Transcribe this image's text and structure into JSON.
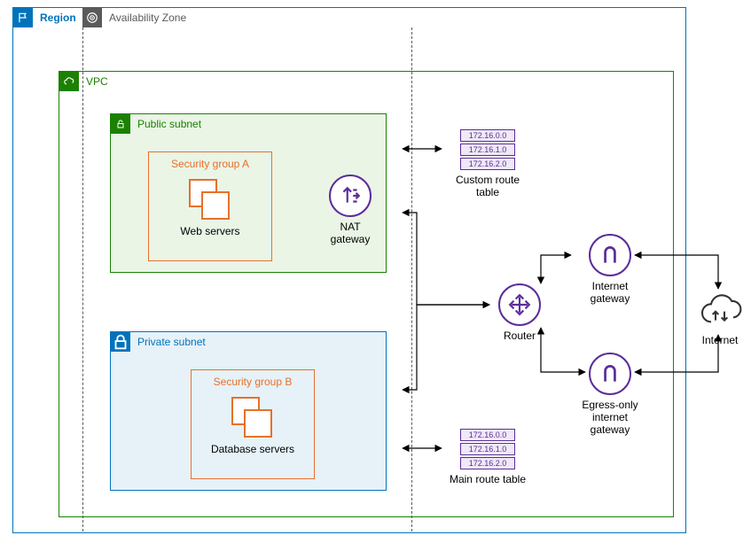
{
  "region": {
    "label": "Region"
  },
  "availability_zone": {
    "label": "Availability Zone"
  },
  "vpc": {
    "label": "VPC"
  },
  "public_subnet": {
    "label": "Public subnet"
  },
  "private_subnet": {
    "label": "Private subnet"
  },
  "security_group_a": {
    "label": "Security group A",
    "servers_label": "Web servers"
  },
  "security_group_b": {
    "label": "Security group B",
    "servers_label": "Database servers"
  },
  "nat_gateway": {
    "label": "NAT gateway"
  },
  "router": {
    "label": "Router"
  },
  "internet_gateway": {
    "label": "Internet\ngateway"
  },
  "egress_gateway": {
    "label": "Egress-only\ninternet\ngateway"
  },
  "internet": {
    "label": "Internet"
  },
  "custom_route_table": {
    "label": "Custom route table",
    "rows": [
      "172.16.0.0",
      "172.16.1.0",
      "172.16.2.0"
    ]
  },
  "main_route_table": {
    "label": "Main route table",
    "rows": [
      "172.16.0.0",
      "172.16.1.0",
      "172.16.2.0"
    ]
  }
}
